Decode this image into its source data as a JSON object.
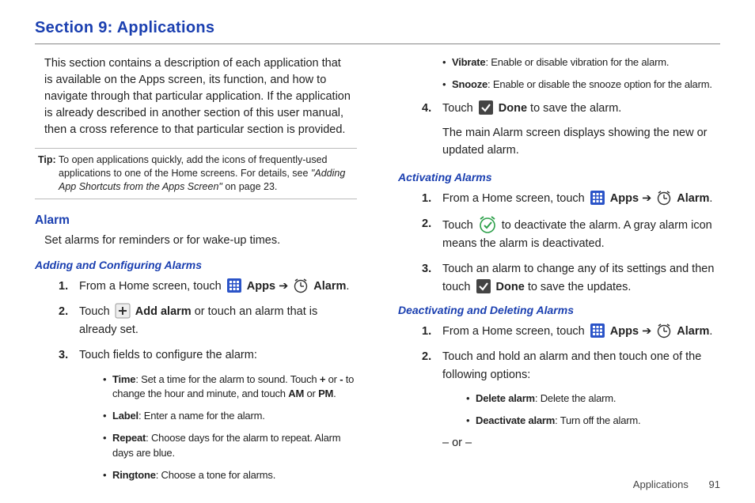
{
  "sectionTitle": "Section 9:  Applications",
  "intro": "This section contains a description of each application that is available on the Apps screen, its function, and how to navigate through that particular application. If the application is already described in another section of this user manual, then a cross reference to that particular section is provided.",
  "tip": {
    "label": "Tip:",
    "body1": " To open applications quickly, add the icons of frequently-used applications to one of the Home screens. For details, see ",
    "italic": "\"Adding App Shortcuts from the Apps Screen\"",
    "body2": " on page 23."
  },
  "alarm": {
    "heading": "Alarm",
    "desc": "Set alarms for reminders or for wake-up times."
  },
  "adding": {
    "heading": "Adding and Configuring Alarms",
    "step1a": "From a Home screen, touch ",
    "apps": " Apps ",
    "arrow": "➔ ",
    "alarm": " Alarm",
    "step2a": "Touch ",
    "addAlarm": " Add alarm",
    "step2b": " or touch an alarm that is already set.",
    "step3": "Touch fields to configure the alarm:",
    "bullets": {
      "time_l": "Time",
      "time_b": ": Set a time for the alarm to sound. Touch ",
      "time_plus": "+",
      "time_mid": " or ",
      "time_minus": "-",
      "time_mid2": " to change the hour and minute, and touch ",
      "time_am": "AM",
      "time_or": " or ",
      "time_pm": "PM",
      "time_end": ".",
      "label_l": "Label",
      "label_b": ": Enter a name for the alarm.",
      "repeat_l": "Repeat",
      "repeat_b": ": Choose days for the alarm to repeat. Alarm days are blue.",
      "ringtone_l": "Ringtone",
      "ringtone_b": ": Choose a tone for alarms."
    }
  },
  "col2bullets": {
    "vibrate_l": "Vibrate",
    "vibrate_b": ": Enable or disable vibration for the alarm.",
    "snooze_l": "Snooze",
    "snooze_b": ": Enable or disable the snooze option for the alarm."
  },
  "step4": {
    "a": "Touch ",
    "done": " Done",
    "b": " to save the alarm."
  },
  "step4cont": "The main Alarm screen displays showing the new or updated alarm.",
  "activating": {
    "heading": "Activating Alarms",
    "s1a": "From a Home screen, touch ",
    "s2a": "Touch ",
    "s2b": " to deactivate the alarm. A gray alarm icon means the alarm is deactivated.",
    "s3a": "Touch an alarm to change any of its settings and then touch ",
    "s3done": " Done",
    "s3b": " to save the updates."
  },
  "deactivating": {
    "heading": "Deactivating and Deleting Alarms",
    "s1a": "From a Home screen, touch ",
    "s2": "Touch and hold an alarm and then touch one of the following options:",
    "b1l": "Delete alarm",
    "b1b": ": Delete the alarm.",
    "b2l": "Deactivate alarm",
    "b2b": ": Turn off the alarm.",
    "or": "– or –"
  },
  "footer": {
    "section": "Applications",
    "page": "91"
  }
}
